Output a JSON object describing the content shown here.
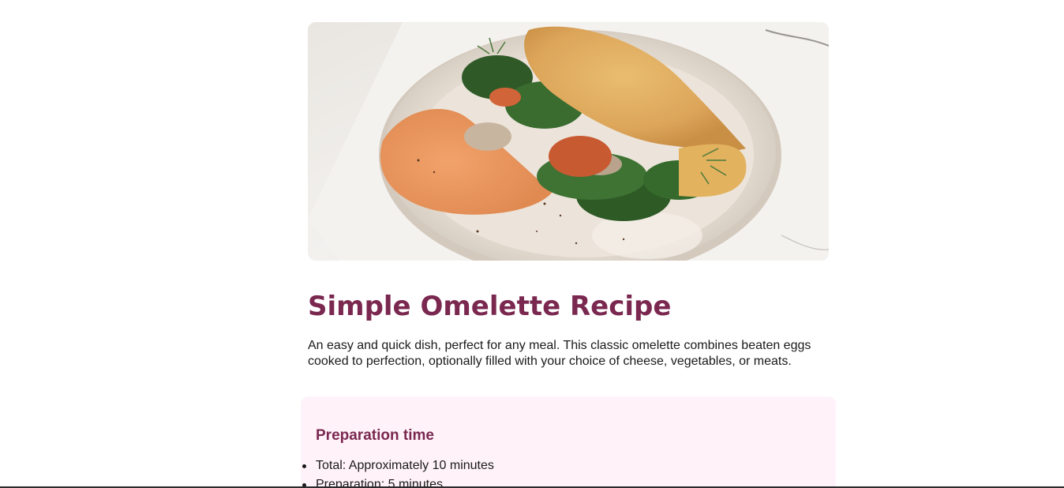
{
  "hero": {
    "alt": "Omelette with spinach, mushrooms and dill on a ceramic plate"
  },
  "recipe": {
    "title": "Simple Omelette Recipe",
    "description": "An easy and quick dish, perfect for any meal. This classic omelette combines beaten eggs cooked to perfection, optionally filled with your choice of cheese, vegetables, or meats."
  },
  "preparation": {
    "heading": "Preparation time",
    "items": [
      "Total: Approximately 10 minutes",
      "Preparation: 5 minutes"
    ]
  },
  "colors": {
    "accent": "#7a2850",
    "panel_bg": "#fff3f9",
    "text": "#1a1a1a"
  }
}
